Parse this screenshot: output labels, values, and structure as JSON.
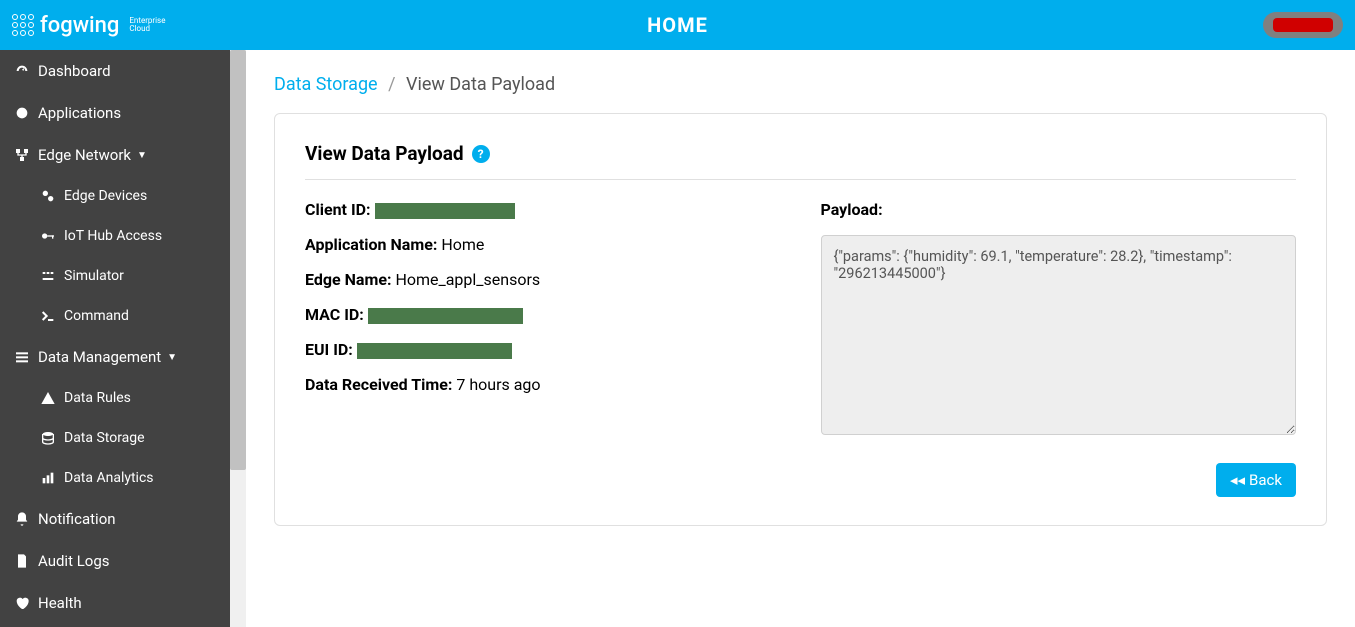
{
  "brand": {
    "name": "fogwing",
    "sub1": "Enterprise",
    "sub2": "Cloud"
  },
  "header": {
    "title": "HOME"
  },
  "sidebar": {
    "items": [
      {
        "label": "Dashboard",
        "icon": "gauge"
      },
      {
        "label": "Applications",
        "icon": "circle"
      },
      {
        "label": "Edge Network",
        "icon": "network",
        "expandable": true
      },
      {
        "label": "Edge Devices",
        "icon": "cogs",
        "sub": true
      },
      {
        "label": "IoT Hub Access",
        "icon": "key",
        "sub": true
      },
      {
        "label": "Simulator",
        "icon": "dashes",
        "sub": true
      },
      {
        "label": "Command",
        "icon": "terminal",
        "sub": true
      },
      {
        "label": "Data Management",
        "icon": "list",
        "expandable": true
      },
      {
        "label": "Data Rules",
        "icon": "warn",
        "sub": true
      },
      {
        "label": "Data Storage",
        "icon": "db",
        "sub": true
      },
      {
        "label": "Data Analytics",
        "icon": "chart",
        "sub": true
      },
      {
        "label": "Notification",
        "icon": "bell"
      },
      {
        "label": "Audit Logs",
        "icon": "doc"
      },
      {
        "label": "Health",
        "icon": "heart"
      }
    ]
  },
  "breadcrumb": {
    "root": "Data Storage",
    "current": "View Data Payload"
  },
  "card": {
    "title": "View Data Payload",
    "fields": {
      "client_id_label": "Client ID:",
      "app_name_label": "Application Name:",
      "app_name_value": "Home",
      "edge_name_label": "Edge Name:",
      "edge_name_value": "Home_appl_sensors",
      "mac_id_label": "MAC ID:",
      "eui_id_label": "EUI ID:",
      "recv_time_label": "Data Received Time:",
      "recv_time_value": "7 hours ago",
      "payload_label": "Payload:"
    },
    "payload_text": "{\"params\": {\"humidity\": 69.1, \"temperature\": 28.2}, \"timestamp\": \"296213445000\"}",
    "back_label": "Back"
  }
}
